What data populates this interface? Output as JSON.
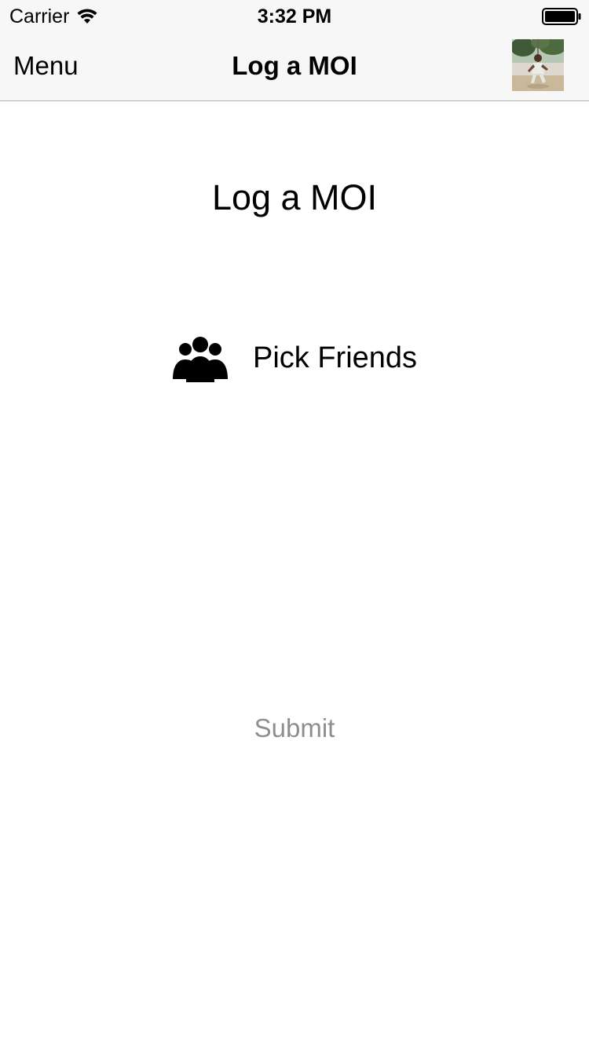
{
  "status_bar": {
    "carrier": "Carrier",
    "time": "3:32 PM",
    "wifi_icon": "wifi-icon",
    "battery_icon": "battery-full-icon"
  },
  "nav_bar": {
    "menu_label": "Menu",
    "title": "Log a MOI",
    "avatar": "profile-avatar",
    "background_color": "#f7f7f7"
  },
  "main": {
    "heading": "Log a MOI",
    "pick_friends": {
      "icon": "group-people-icon",
      "label": "Pick Friends"
    },
    "submit_label": "Submit",
    "submit_color": "#8e8e8e"
  }
}
